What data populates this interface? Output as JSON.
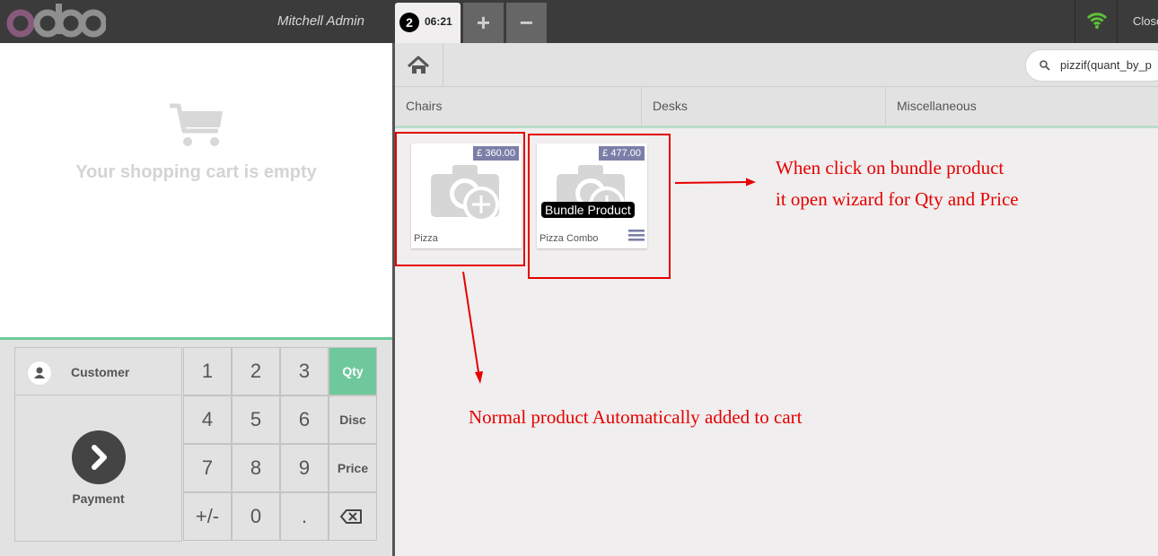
{
  "header": {
    "user_name": "Mitchell Admin",
    "order_number": "2",
    "order_time": "06:21",
    "add_order_symbol": "+",
    "remove_order_symbol": "−",
    "close_label": "Close",
    "icons": [
      "odoo-logo",
      "wifi-icon"
    ]
  },
  "cart": {
    "empty_message": "Your shopping cart is empty",
    "icon": "cart-icon"
  },
  "controls": {
    "customer_label": "Customer",
    "payment_label": "Payment",
    "numpad": {
      "k1": "1",
      "k2": "2",
      "k3": "3",
      "k4": "4",
      "k5": "5",
      "k6": "6",
      "k7": "7",
      "k8": "8",
      "k9": "9",
      "sign": "+/-",
      "k0": "0",
      "dot": "."
    },
    "modes": {
      "qty": "Qty",
      "disc": "Disc",
      "price": "Price"
    },
    "active_mode": "Qty",
    "accent_color": "#6ec89b"
  },
  "breadcrumb": {
    "home_icon": "home-icon"
  },
  "search": {
    "value": "pizzif(quant_by_p"
  },
  "categories": [
    "Chairs",
    "Desks",
    "Miscellaneous"
  ],
  "products": [
    {
      "name": "Pizza",
      "price": "£ 360.00"
    },
    {
      "name": "Pizza Combo",
      "price": "£ 477.00",
      "badge": "Bundle Product"
    }
  ],
  "annotations": {
    "bundle_line1": "When click on bundle product",
    "bundle_line2": "it open wizard for Qty and Price",
    "normal": "Normal product Automatically added to cart",
    "color": "#e60000"
  }
}
